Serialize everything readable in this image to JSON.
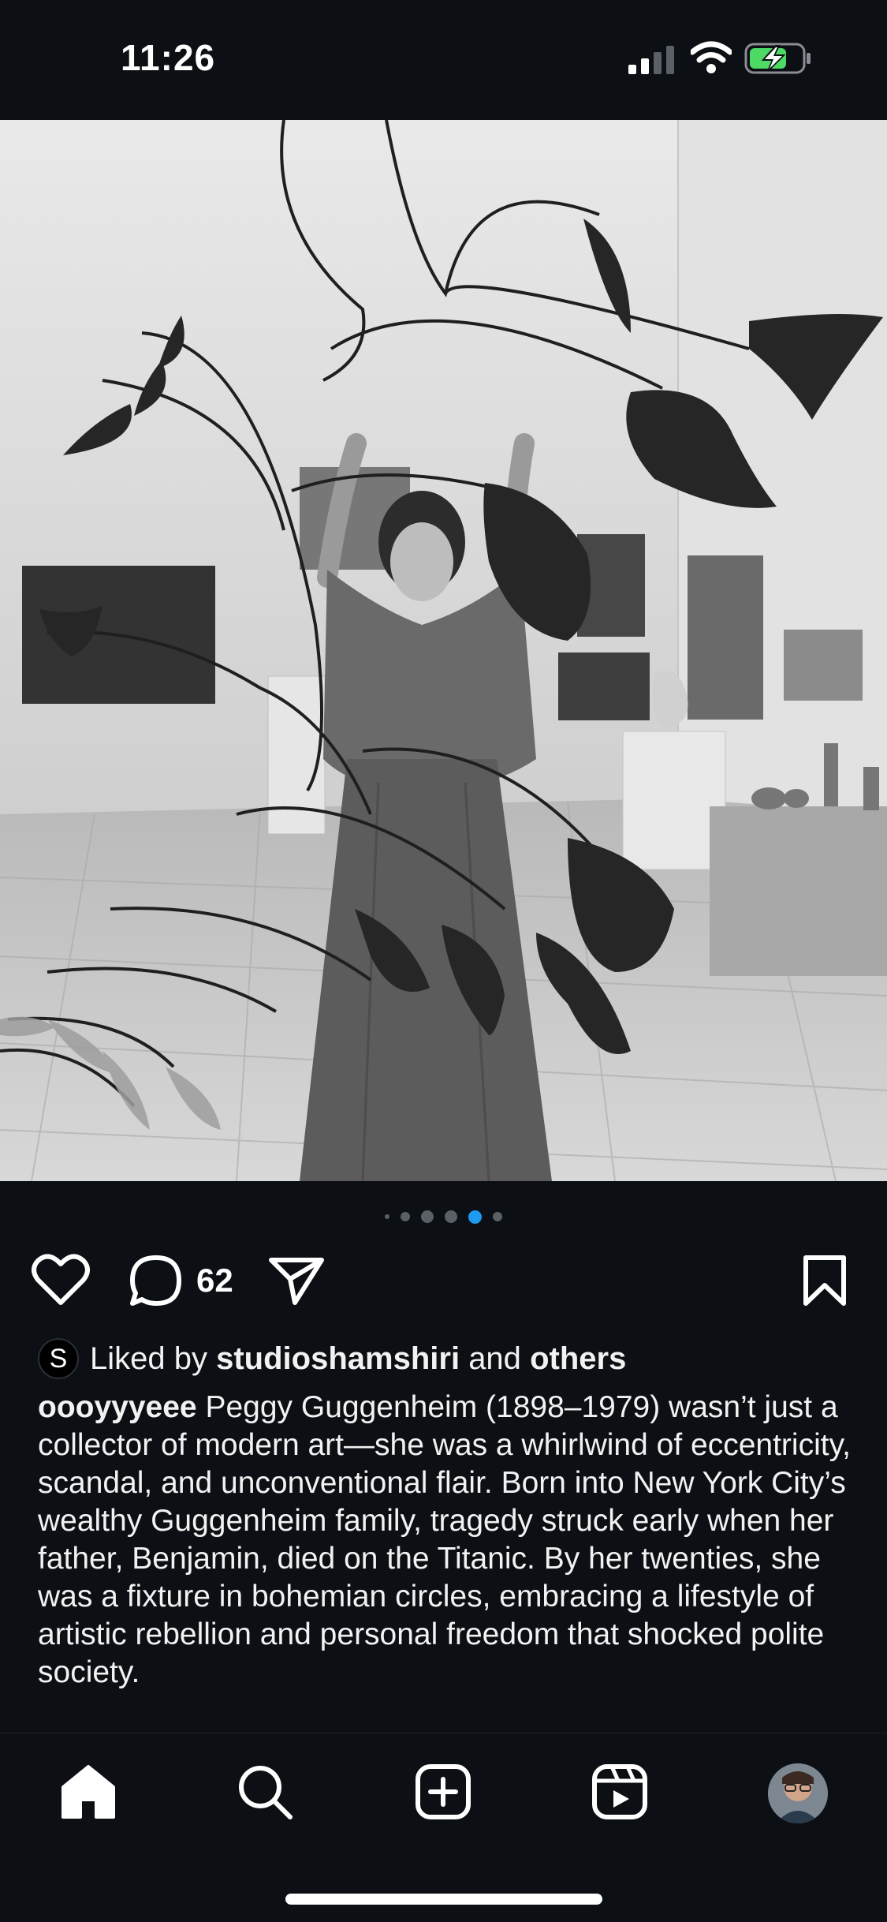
{
  "status_bar": {
    "time": "11:26",
    "icons": [
      "cellular-signal-icon",
      "wifi-icon",
      "battery-charging-icon"
    ],
    "battery_color": "#4cd964"
  },
  "post": {
    "image_alt": "Black and white photograph of a woman reaching up toward a hanging mobile sculpture in a gallery",
    "carousel": {
      "total_dots": 6,
      "active_index": 4
    },
    "actions": {
      "like_icon": "heart-outline-icon",
      "comment_icon": "comment-bubble-icon",
      "comment_count": "62",
      "share_icon": "paper-plane-icon",
      "save_icon": "bookmark-outline-icon"
    },
    "likes": {
      "avatar_letter": "S",
      "prefix": "Liked by",
      "user": "studioshamshiri",
      "connector": "and",
      "others": "others"
    },
    "caption": {
      "username": "oooyyyeee",
      "text": "Peggy Guggenheim (1898–1979) wasn’t just a collector of modern art—she was a whirlwind of eccentricity, scandal, and unconventional flair. Born into New York City’s wealthy Guggenheim family, tragedy struck early when her father, Benjamin, died on the Titanic. By her twenties, she was a fixture in bohemian circles, embracing a lifestyle of artistic rebellion and personal freedom that shocked polite society."
    }
  },
  "bottom_nav": {
    "items": [
      "home-icon",
      "search-icon",
      "create-icon",
      "reels-icon",
      "profile-avatar"
    ],
    "active": "home-icon"
  },
  "colors": {
    "background": "#0c0f14",
    "active_dot": "#1d9bf0",
    "text": "#f2f2f2"
  }
}
